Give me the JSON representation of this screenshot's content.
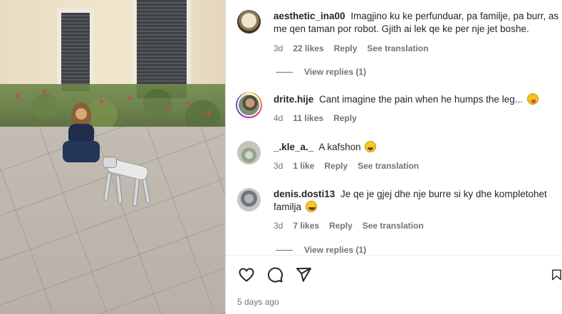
{
  "post": {
    "timestamp": "5 days ago"
  },
  "comments": [
    {
      "username": "aesthetic_ina00",
      "text": "Imagjino ku ke perfunduar, pa familje, pa burr, as me qen taman por robot. Gjith ai lek qe ke per nje jet boshe.",
      "time": "3d",
      "likes": "22 likes",
      "reply": "Reply",
      "translation": "See translation",
      "view_replies": "View replies (1)"
    },
    {
      "username": "drite.hije",
      "text": "Cant imagine the pain when he humps the leg...",
      "emoji": "face-with-tongue",
      "time": "4d",
      "likes": "11 likes",
      "reply": "Reply"
    },
    {
      "username": "_.kle_a._",
      "text": "A kafshon",
      "emoji": "rolling-on-floor-laughing",
      "time": "3d",
      "likes": "1 like",
      "reply": "Reply",
      "translation": "See translation"
    },
    {
      "username": "denis.dosti13",
      "text": "Je qe je gjej dhe nje burre si ky dhe kompletohet familja",
      "emoji": "face-with-tears-of-joy",
      "time": "3d",
      "likes": "7 likes",
      "reply": "Reply",
      "translation": "See translation",
      "view_replies": "View replies (1)"
    }
  ],
  "icons": {
    "like": "heart-icon",
    "comment": "comment-bubble-icon",
    "share": "paper-plane-icon",
    "save": "bookmark-icon"
  }
}
